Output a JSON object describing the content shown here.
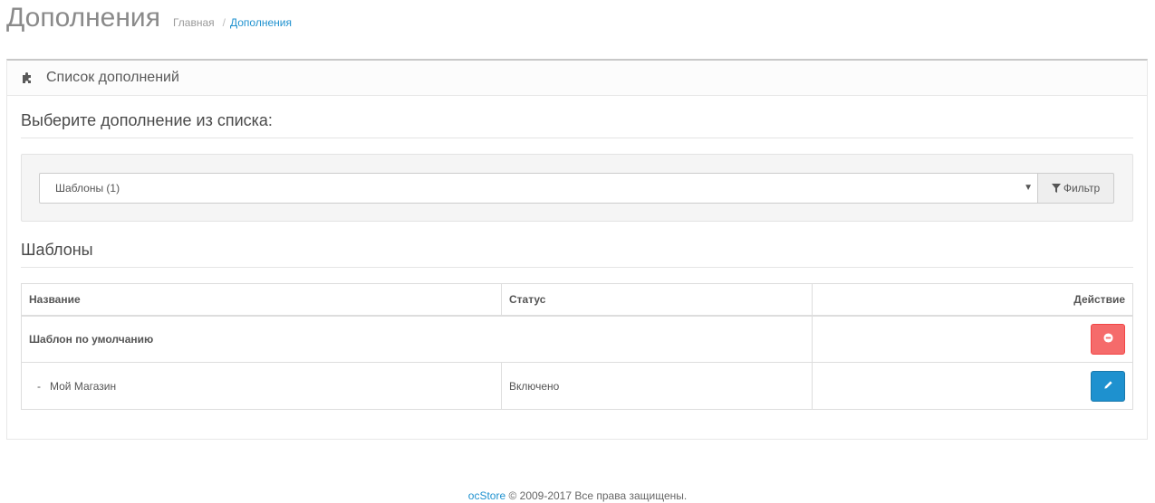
{
  "header": {
    "title": "Дополнения",
    "breadcrumb": {
      "home": "Главная",
      "separator": "/",
      "current": "Дополнения"
    }
  },
  "panel": {
    "title": "Список дополнений",
    "choose_legend": "Выберите дополнение из списка:",
    "filter": {
      "selected": "Шаблоны (1)",
      "button_label": "Фильтр"
    },
    "section_title": "Шаблоны",
    "table": {
      "headers": {
        "name": "Название",
        "status": "Статус",
        "action": "Действие"
      },
      "rows": [
        {
          "name": "Шаблон по умолчанию",
          "status": "",
          "action": "uninstall"
        },
        {
          "prefix": "-",
          "name": "Мой Магазин",
          "status": "Включено",
          "action": "edit"
        }
      ]
    }
  },
  "footer": {
    "brand": "ocStore",
    "text": "© 2009-2017 Все права защищены."
  },
  "colors": {
    "accent": "#1e91cf",
    "danger": "#f56b6b",
    "title": "#8a8a8a"
  },
  "icons": {
    "panel": "puzzle-icon",
    "filter": "filter-icon",
    "uninstall": "minus-circle-icon",
    "edit": "pencil-icon"
  }
}
